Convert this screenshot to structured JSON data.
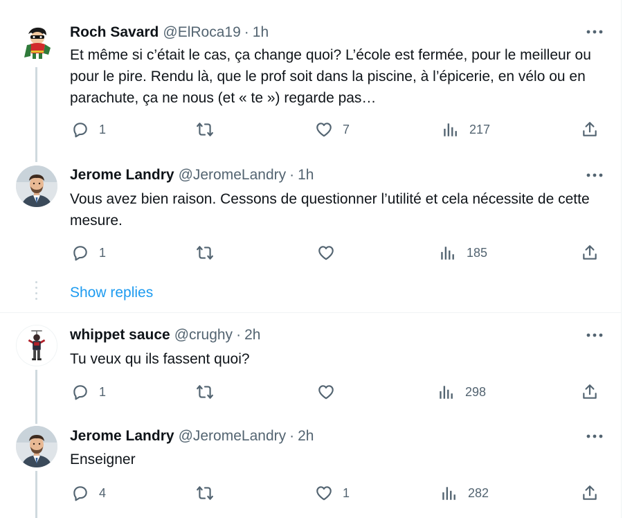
{
  "tweets": [
    {
      "name": "Roch Savard",
      "handle": "@ElRoca19",
      "time": "1h",
      "text": "Et même si c’était le cas, ça change quoi? L’école est fermée, pour le meilleur ou pour le pire. Rendu là, que le prof soit dans la piscine, à l’épicerie, en vélo ou en parachute, ça ne nous (et « te ») regarde pas…",
      "replies": "1",
      "retweets": "",
      "likes": "7",
      "views": "217"
    },
    {
      "name": "Jerome Landry",
      "handle": "@JeromeLandry",
      "time": "1h",
      "text": "Vous avez bien raison. Cessons de questionner l’utilité et cela nécessite de cette mesure.",
      "replies": "1",
      "retweets": "",
      "likes": "",
      "views": "185"
    },
    {
      "name": "whippet sauce",
      "handle": "@crughy",
      "time": "2h",
      "text": "Tu veux qu ils fassent quoi?",
      "replies": "1",
      "retweets": "",
      "likes": "",
      "views": "298"
    },
    {
      "name": "Jerome Landry",
      "handle": "@JeromeLandry",
      "time": "2h",
      "text": "Enseigner",
      "replies": "4",
      "retweets": "",
      "likes": "1",
      "views": "282"
    }
  ],
  "show_replies_label": "Show replies",
  "separator": "·",
  "icons": {
    "reply": "reply-icon",
    "retweet": "retweet-icon",
    "like": "heart-icon",
    "views": "views-icon",
    "share": "share-icon",
    "more": "more-icon"
  },
  "colors": {
    "link": "#1d9bf0",
    "secondary": "#536471",
    "thread_line": "#cfd9de"
  }
}
